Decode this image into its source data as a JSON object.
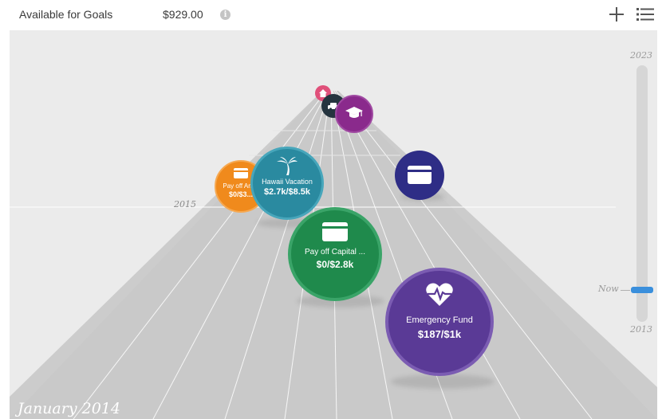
{
  "header": {
    "available_label": "Available for Goals",
    "available_amount": "$929.00",
    "info_icon": "info-icon",
    "add_icon": "plus-icon",
    "list_icon": "list-icon"
  },
  "timeline": {
    "top_year": "2023",
    "bottom_year": "2013",
    "now_label": "Now"
  },
  "road": {
    "year_marker": "2015",
    "current_month": "January 2014"
  },
  "goals": [
    {
      "name": "Emergency Fund",
      "amount": "$187/$1k",
      "icon": "heart-pulse-icon",
      "color": "#5a3a96",
      "progress": 0.187
    },
    {
      "name": "Pay off Capital ...",
      "amount": "$0/$2.8k",
      "icon": "credit-card-icon",
      "color": "#1f8a4c",
      "progress": 0
    },
    {
      "name": "Hawaii Vacation",
      "amount": "$2.7k/$8.5k",
      "icon": "palm-tree-icon",
      "color": "#2a8aa0",
      "progress": 0.32
    },
    {
      "name": "Pay off Am...",
      "amount": "$0/$3...",
      "icon": "credit-card-icon",
      "color": "#f08a1c",
      "progress": 0
    },
    {
      "name": "",
      "amount": "",
      "icon": "credit-card-icon",
      "color": "#2e2d86",
      "progress": 0
    },
    {
      "name": "",
      "amount": "",
      "icon": "graduation-cap-icon",
      "color": "#8a2a8c",
      "progress": 0
    },
    {
      "name": "",
      "amount": "",
      "icon": "car-icon",
      "color": "#25343f",
      "progress": 0
    },
    {
      "name": "",
      "amount": "",
      "icon": "home-icon",
      "color": "#e0507a",
      "progress": 0
    }
  ]
}
